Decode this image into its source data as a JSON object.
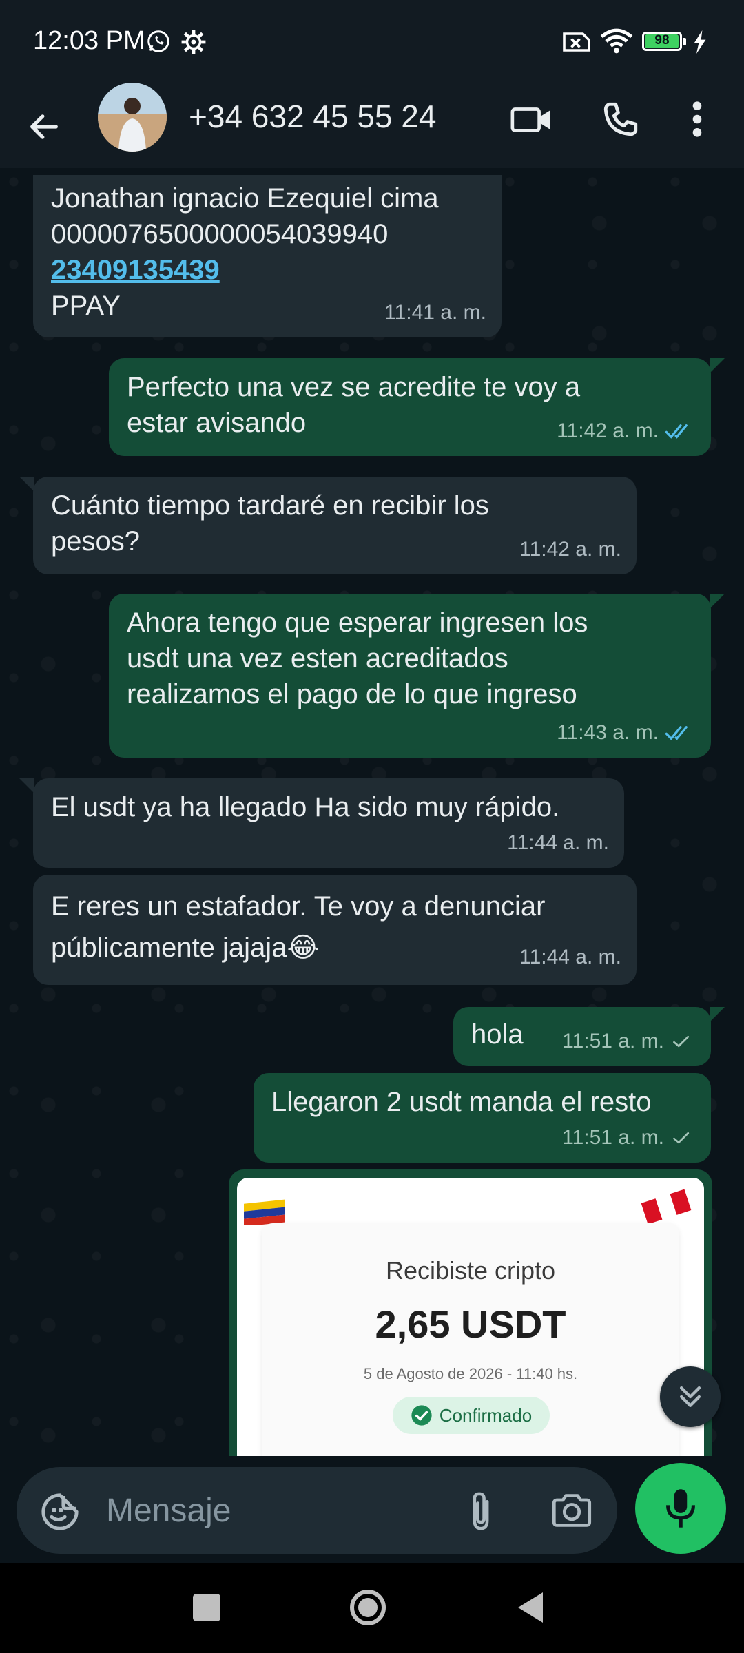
{
  "status_bar": {
    "time": "12:03 PM",
    "battery": "98",
    "battery_level": 0.98
  },
  "header": {
    "contact_name": "+34 632 45 55 24"
  },
  "messages": [
    {
      "direction": "in",
      "lines": [
        "Jonathan ignacio Ezequiel cima",
        "0000076500000054039940"
      ],
      "link": "23409135439",
      "last_line": "PPAY",
      "time": "11:41 a. m."
    },
    {
      "direction": "out",
      "text": "Perfecto una vez se acredite te voy a estar avisando",
      "time": "11:42 a. m.",
      "status": "read"
    },
    {
      "direction": "in",
      "text": "Cuánto tiempo tardaré en recibir los pesos?",
      "time": "11:42 a. m."
    },
    {
      "direction": "out",
      "text": "Ahora tengo que esperar ingresen los usdt una vez esten acreditados realizamos el pago de lo que ingreso",
      "time": "11:43 a. m.",
      "status": "read"
    },
    {
      "direction": "in",
      "text": "El usdt ya ha llegado Ha sido muy rápido.",
      "time": "11:44 a. m."
    },
    {
      "direction": "in",
      "text": "E reres un estafador. Te voy a denunciar públicamente jajaja😂",
      "time": "11:44 a. m."
    },
    {
      "direction": "out",
      "text": "hola",
      "time": "11:51 a. m.",
      "status": "sent"
    },
    {
      "direction": "out",
      "text": "Llegaron 2 usdt manda el resto",
      "time": "11:51 a. m.",
      "status": "sent"
    }
  ],
  "receipt": {
    "title": "Recibiste cripto",
    "amount": "2,65 USDT",
    "date": "5 de Agosto de 2026 - 11:40 hs.",
    "badge": "Confirmado"
  },
  "composer": {
    "placeholder": "Mensaje"
  },
  "colors": {
    "incoming_bubble": "#202c33",
    "outgoing_bubble": "#144d37",
    "accent_green": "#21c063",
    "read_tick": "#53bdeb"
  },
  "icons": [
    "whatsapp-icon",
    "gear-icon",
    "sim-icon",
    "wifi-icon",
    "battery-icon",
    "charging-icon",
    "back-arrow-icon",
    "video-call-icon",
    "phone-icon",
    "more-vert-icon",
    "double-check-icon",
    "check-icon",
    "emoji-icon",
    "attach-icon",
    "camera-icon",
    "mic-icon",
    "scroll-down-icon"
  ]
}
